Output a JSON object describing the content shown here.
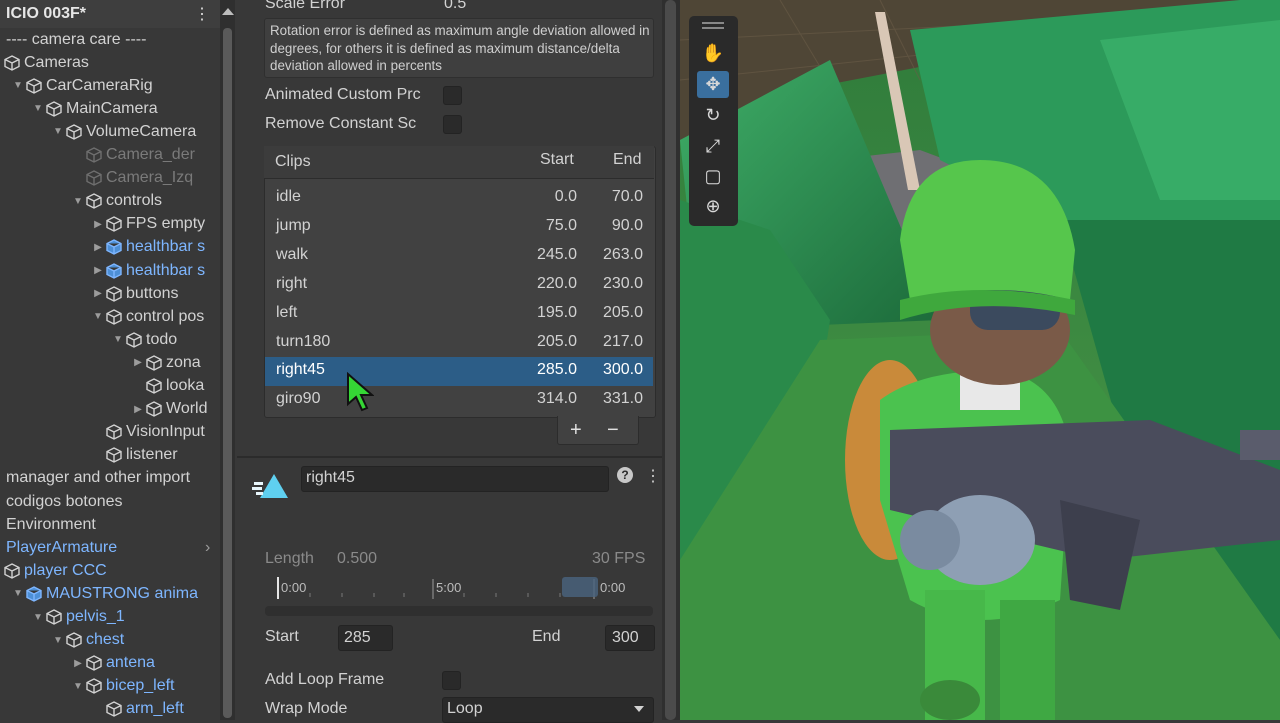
{
  "hierarchy": {
    "title": "ICIO 003F*",
    "items": [
      {
        "label": "---- camera care ----",
        "depth": 0,
        "icon": "none",
        "arrow": "none",
        "style": "normal"
      },
      {
        "label": "Cameras",
        "depth": 0,
        "icon": "cube",
        "arrow": "none",
        "style": "normal"
      },
      {
        "label": "CarCameraRig",
        "depth": 1,
        "icon": "cube",
        "arrow": "down",
        "style": "normal"
      },
      {
        "label": "MainCamera",
        "depth": 2,
        "icon": "cube",
        "arrow": "down",
        "style": "normal"
      },
      {
        "label": "VolumeCamera",
        "depth": 3,
        "icon": "cube",
        "arrow": "down",
        "style": "normal"
      },
      {
        "label": "Camera_der",
        "depth": 4,
        "icon": "cube",
        "arrow": "none",
        "style": "dim"
      },
      {
        "label": "Camera_Izq",
        "depth": 4,
        "icon": "cube",
        "arrow": "none",
        "style": "dim"
      },
      {
        "label": "controls",
        "depth": 4,
        "icon": "cube",
        "arrow": "down",
        "style": "normal"
      },
      {
        "label": "FPS empty",
        "depth": 5,
        "icon": "cube",
        "arrow": "right",
        "style": "normal"
      },
      {
        "label": "healthbar s",
        "depth": 5,
        "icon": "prefab",
        "arrow": "right",
        "style": "blue"
      },
      {
        "label": "healthbar s",
        "depth": 5,
        "icon": "prefab",
        "arrow": "right",
        "style": "blue"
      },
      {
        "label": "buttons",
        "depth": 5,
        "icon": "cube",
        "arrow": "right",
        "style": "normal"
      },
      {
        "label": "control pos",
        "depth": 5,
        "icon": "cube",
        "arrow": "down",
        "style": "normal"
      },
      {
        "label": "todo",
        "depth": 6,
        "icon": "cube",
        "arrow": "down",
        "style": "normal"
      },
      {
        "label": "zona",
        "depth": 7,
        "icon": "cube",
        "arrow": "right",
        "style": "normal"
      },
      {
        "label": "looka",
        "depth": 7,
        "icon": "cube",
        "arrow": "none",
        "style": "normal"
      },
      {
        "label": "World",
        "depth": 7,
        "icon": "cube",
        "arrow": "right",
        "style": "normal"
      },
      {
        "label": "VisionInput",
        "depth": 5,
        "icon": "cube",
        "arrow": "none",
        "style": "normal"
      },
      {
        "label": "listener",
        "depth": 5,
        "icon": "cube",
        "arrow": "none",
        "style": "normal"
      },
      {
        "label": "manager and other import",
        "depth": 0,
        "icon": "none",
        "arrow": "none",
        "style": "normal"
      },
      {
        "label": "codigos botones",
        "depth": 0,
        "icon": "none",
        "arrow": "none",
        "style": "normal"
      },
      {
        "label": "Environment",
        "depth": 0,
        "icon": "none",
        "arrow": "none",
        "style": "normal"
      },
      {
        "label": "PlayerArmature",
        "depth": 0,
        "icon": "none",
        "arrow": "none",
        "style": "blue",
        "trailing": "›"
      },
      {
        "label": "player CCC",
        "depth": 0,
        "icon": "cube",
        "arrow": "none",
        "style": "blue"
      },
      {
        "label": "MAUSTRONG anima",
        "depth": 1,
        "icon": "prefab",
        "arrow": "down",
        "style": "blue"
      },
      {
        "label": "pelvis_1",
        "depth": 2,
        "icon": "cube",
        "arrow": "down",
        "style": "blue"
      },
      {
        "label": "chest",
        "depth": 3,
        "icon": "cube",
        "arrow": "down",
        "style": "blue"
      },
      {
        "label": "antena",
        "depth": 4,
        "icon": "cube",
        "arrow": "right",
        "style": "blue"
      },
      {
        "label": "bicep_left",
        "depth": 4,
        "icon": "cube",
        "arrow": "down",
        "style": "blue"
      },
      {
        "label": "arm_left",
        "depth": 5,
        "icon": "cube",
        "arrow": "none",
        "style": "blue"
      }
    ]
  },
  "inspector": {
    "scale_error_label": "Scale Error",
    "scale_error_value": "0.5",
    "help_text": "Rotation error is defined as maximum angle deviation allowed in degrees, for others it is defined as maximum distance/delta deviation allowed in percents",
    "animated_custom_label": "Animated Custom Prc",
    "remove_constant_label": "Remove Constant Sc",
    "clips_header": {
      "name": "Clips",
      "start": "Start",
      "end": "End"
    },
    "clips": [
      {
        "name": "idle",
        "start": "0.0",
        "end": "70.0",
        "selected": false
      },
      {
        "name": "jump",
        "start": "75.0",
        "end": "90.0",
        "selected": false
      },
      {
        "name": "walk",
        "start": "245.0",
        "end": "263.0",
        "selected": false
      },
      {
        "name": "right",
        "start": "220.0",
        "end": "230.0",
        "selected": false
      },
      {
        "name": "left",
        "start": "195.0",
        "end": "205.0",
        "selected": false
      },
      {
        "name": "turn180",
        "start": "205.0",
        "end": "217.0",
        "selected": false
      },
      {
        "name": "right45",
        "start": "285.0",
        "end": "300.0",
        "selected": true
      },
      {
        "name": "giro90",
        "start": "314.0",
        "end": "331.0",
        "selected": false
      }
    ],
    "add_label": "+",
    "remove_label": "−",
    "clip_name": "right45",
    "help_icon": "?",
    "more_icon": "⋮",
    "length_label": "Length",
    "length_value": "0.500",
    "fps_label": "30 FPS",
    "timeline_marks": [
      "0:00",
      "5:00",
      "0:00"
    ],
    "start_label": "Start",
    "start_value": "285",
    "end_label": "End",
    "end_value": "300",
    "add_loop_label": "Add Loop Frame",
    "wrap_mode_label": "Wrap Mode",
    "wrap_mode_value": "Loop"
  },
  "scene": {
    "tools": [
      "hand-tool-icon",
      "move-tool-icon",
      "rotate-tool-icon",
      "scale-tool-icon",
      "rect-tool-icon",
      "transform-tool-icon"
    ],
    "active_tool": 1
  },
  "colors": {
    "selection": "#2c5d87",
    "prefab_blue": "#7eb6ff",
    "panel_bg": "#383838",
    "grass": "#3f8f48"
  }
}
